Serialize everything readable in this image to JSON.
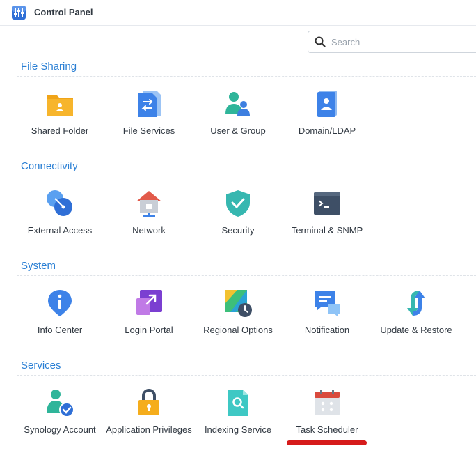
{
  "window": {
    "title": "Control Panel"
  },
  "search": {
    "placeholder": "Search",
    "value": ""
  },
  "sections": [
    {
      "title": "File Sharing",
      "items": [
        {
          "label": "Shared Folder",
          "icon": "shared-folder-icon"
        },
        {
          "label": "File Services",
          "icon": "file-services-icon"
        },
        {
          "label": "User & Group",
          "icon": "user-group-icon"
        },
        {
          "label": "Domain/LDAP",
          "icon": "domain-ldap-icon"
        }
      ]
    },
    {
      "title": "Connectivity",
      "items": [
        {
          "label": "External Access",
          "icon": "external-access-icon"
        },
        {
          "label": "Network",
          "icon": "network-icon"
        },
        {
          "label": "Security",
          "icon": "security-shield-icon"
        },
        {
          "label": "Terminal & SNMP",
          "icon": "terminal-icon"
        }
      ]
    },
    {
      "title": "System",
      "items": [
        {
          "label": "Info Center",
          "icon": "info-center-icon"
        },
        {
          "label": "Login Portal",
          "icon": "login-portal-icon"
        },
        {
          "label": "Regional Options",
          "icon": "regional-options-icon"
        },
        {
          "label": "Notification",
          "icon": "notification-icon"
        },
        {
          "label": "Update & Restore",
          "icon": "update-restore-icon"
        }
      ]
    },
    {
      "title": "Services",
      "items": [
        {
          "label": "Synology Account",
          "icon": "synology-account-icon"
        },
        {
          "label": "Application Privileges",
          "icon": "application-privileges-icon"
        },
        {
          "label": "Indexing Service",
          "icon": "indexing-service-icon"
        },
        {
          "label": "Task Scheduler",
          "icon": "task-scheduler-icon"
        }
      ]
    }
  ],
  "colors": {
    "section_title": "#2a7fd4",
    "highlight_underline": "#d61b1b"
  }
}
